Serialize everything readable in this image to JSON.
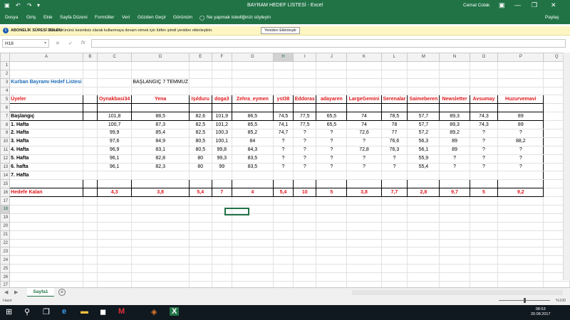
{
  "titlebar": {
    "title": "BAYRAM HEDEF LİSTESİ  -  Excel",
    "user": "Cemal Colak",
    "save_icon": "▣",
    "undo_icon": "↶",
    "redo_icon": "↷",
    "customize_icon": "▾",
    "minimize": "—",
    "maximize": "❐",
    "close": "✕",
    "restore_ribbon": "▣"
  },
  "ribbon": {
    "tabs": [
      "Dosya",
      "Giriş",
      "Ekle",
      "Sayfa Düzeni",
      "Formüller",
      "Veri",
      "Gözden Geçir",
      "Görünüm"
    ],
    "tellme": "Ne yapmak istediğinizi söyleyin",
    "share": "Paylaş"
  },
  "message_bar": {
    "title": "ABONELİK SÜRESİ DOLDU",
    "text": "Excel ürününü kesintisiz olarak kullanmaya devam etmek için lütfen şimdi yeniden etkinleştirin.",
    "button": "Yeniden Etkinleştir",
    "close": "✕"
  },
  "formula_bar": {
    "namebox": "H18",
    "dropdown": "▾",
    "cancel": "✕",
    "enter": "✓",
    "fx": "fx",
    "value": ""
  },
  "sheet": {
    "columns": [
      "A",
      "B",
      "C",
      "D",
      "E",
      "F",
      "G",
      "H",
      "I",
      "J",
      "K",
      "L",
      "M",
      "N",
      "O",
      "P",
      "Q"
    ],
    "rows": [
      "1",
      "2",
      "3",
      "4",
      "5",
      "6",
      "7",
      "8",
      "9",
      "10",
      "11",
      "12",
      "13",
      "14",
      "15",
      "16",
      "17",
      "18",
      "19",
      "20",
      "21",
      "22",
      "23",
      "24",
      "25",
      "26",
      "27"
    ],
    "list_title": "Kurban Bayramı Hedef Listesi",
    "start_note": "BAŞLANGIÇ 7 TEMMUZ",
    "header_label": "Üyeler",
    "users": [
      "Oynakbasi34",
      "Yena",
      "Işılduru",
      "doga3",
      "Zehra_eymen",
      "yst38",
      "Eddoras",
      "adayaren",
      "LargeGemini",
      "Serenalar",
      "Saimeberen",
      "Newsletter",
      "Avsumay",
      "Huzurvemavi"
    ],
    "data_rows": [
      {
        "label": "Başlangıç",
        "values": [
          "101,8",
          "88,5",
          "82,6",
          "101,9",
          "86,5",
          "74,5",
          "77,5",
          "65,5",
          "74",
          "78,5",
          "57,7",
          "89,3",
          "74,3",
          "89"
        ]
      },
      {
        "label": "1. Hafta",
        "values": [
          "100,7",
          "87,3",
          "82,5",
          "101,2",
          "85,5",
          "74,1",
          "77,5",
          "65,5",
          "74",
          "78",
          "57,7",
          "89,3",
          "74,3",
          "89"
        ]
      },
      {
        "label": "2. Hafta",
        "values": [
          "99,9",
          "85,4",
          "82,5",
          "100,3",
          "85,2",
          "74,7",
          "?",
          "?",
          "72,6",
          "77",
          "57,2",
          "89,2",
          "?",
          "?"
        ]
      },
      {
        "label": "3. Hafta",
        "values": [
          "97,6",
          "84,9",
          "80,5",
          "100,1",
          "84",
          "?",
          "?",
          "?",
          "?",
          "76,6",
          "56,3",
          "89",
          "?",
          "88,2"
        ]
      },
      {
        "label": "4. Hafta",
        "values": [
          "96,9",
          "83,1",
          "80,5",
          "99,8",
          "84,3",
          "?",
          "?",
          "?",
          "72,8",
          "76,3",
          "56,1",
          "89",
          "?",
          "?"
        ]
      },
      {
        "label": "5. Hafta",
        "values": [
          "96,1",
          "82,8",
          "80",
          "99,3",
          "83,5",
          "?",
          "?",
          "?",
          "?",
          "?",
          "55,9",
          "?",
          "?",
          "?"
        ]
      },
      {
        "label": "6. hafta",
        "values": [
          "96,1",
          "82,3",
          "80",
          "99",
          "83,5",
          "?",
          "?",
          "?",
          "?",
          "?",
          "55,4",
          "?",
          "?",
          "?"
        ]
      },
      {
        "label": "7. Hafta",
        "values": [
          "",
          "",
          "",
          "",
          "",
          "",
          "",
          "",
          "",
          "",
          "",
          "",
          "",
          ""
        ]
      }
    ],
    "goal_label": "Hedefe Kalan",
    "goal_values": [
      "4,3",
      "3,8",
      "5,4",
      "7",
      "4",
      "5,4",
      "10",
      "5",
      "3,8",
      "7,7",
      "2,8",
      "9,7",
      "5",
      "9,2"
    ]
  },
  "sheet_tabs": {
    "active": "Sayfa1",
    "prev": "◀",
    "next": "▶",
    "add": "+"
  },
  "statusbar": {
    "status": "Hazır",
    "zoom": "%100",
    "zoom_level": 1.0
  },
  "taskbar": {
    "start_icon": "⊞",
    "search_icon": "⚲",
    "taskview_icon": "❐",
    "edge_icon": "e",
    "explorer_icon": "▬",
    "store_icon": "◼",
    "mcafee_icon": "M",
    "app_icon": "◈",
    "excel_icon": "X",
    "time": "08:53",
    "date": "20.08.2017"
  }
}
